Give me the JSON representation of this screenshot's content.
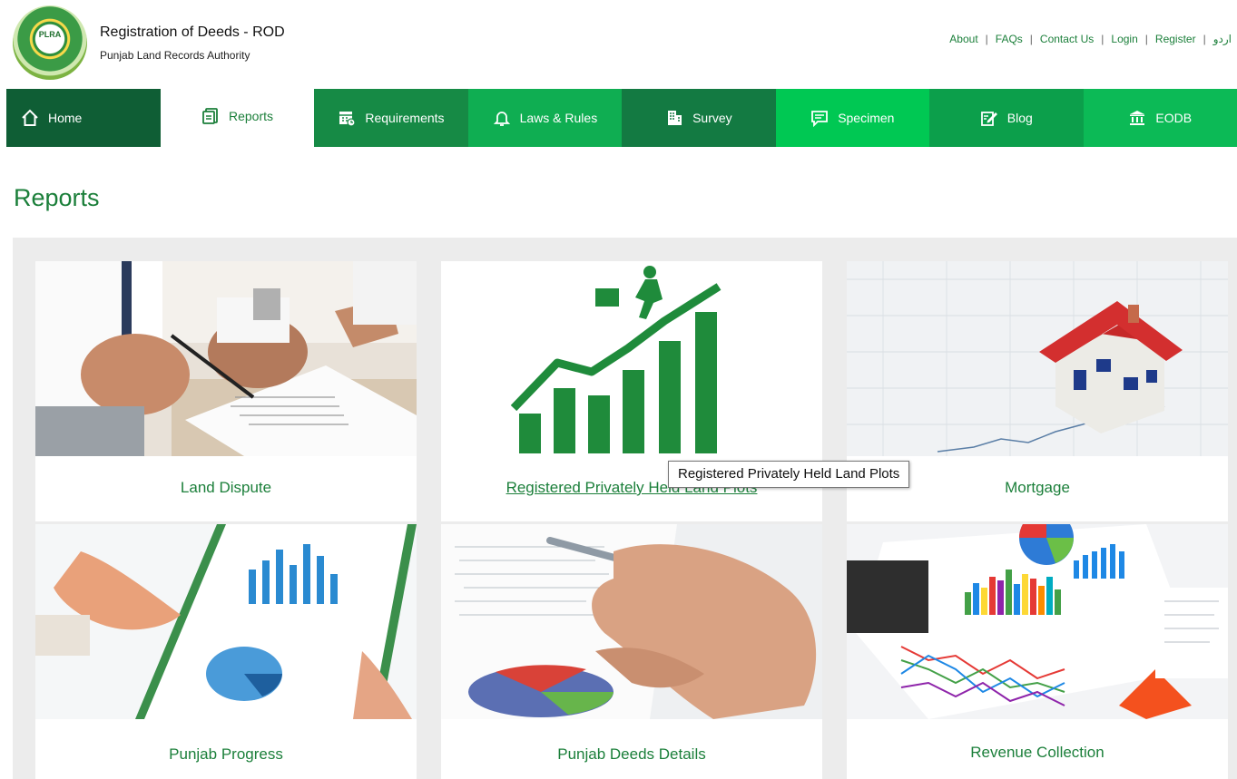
{
  "header": {
    "logo_text": "PLRA",
    "title": "Registration of Deeds - ROD",
    "subtitle": "Punjab Land Records Authority",
    "links": [
      "About",
      "FAQs",
      "Contact Us",
      "Login",
      "Register",
      "اردو"
    ]
  },
  "nav": {
    "items": [
      {
        "label": "Home",
        "icon": "home-icon"
      },
      {
        "label": "Reports",
        "icon": "reports-icon"
      },
      {
        "label": "Requirements",
        "icon": "calendar-icon"
      },
      {
        "label": "Laws & Rules",
        "icon": "bell-icon"
      },
      {
        "label": "Survey",
        "icon": "building-icon"
      },
      {
        "label": "Specimen",
        "icon": "message-icon"
      },
      {
        "label": "Blog",
        "icon": "edit-icon"
      },
      {
        "label": "EODB",
        "icon": "bank-icon"
      }
    ]
  },
  "page": {
    "title": "Reports"
  },
  "cards": [
    {
      "label": "Land Dispute"
    },
    {
      "label": "Registered Privately Held Land Plots"
    },
    {
      "label": "Mortgage"
    },
    {
      "label": "Punjab Progress"
    },
    {
      "label": "Punjab Deeds Details"
    },
    {
      "label": "Revenue Collection"
    }
  ],
  "tooltip": {
    "text": "Registered Privately Held Land Plots"
  },
  "colors": {
    "brand_green": "#1b7f3a",
    "nav_dark": "#0f5e35",
    "grid_bg": "#ececec"
  }
}
